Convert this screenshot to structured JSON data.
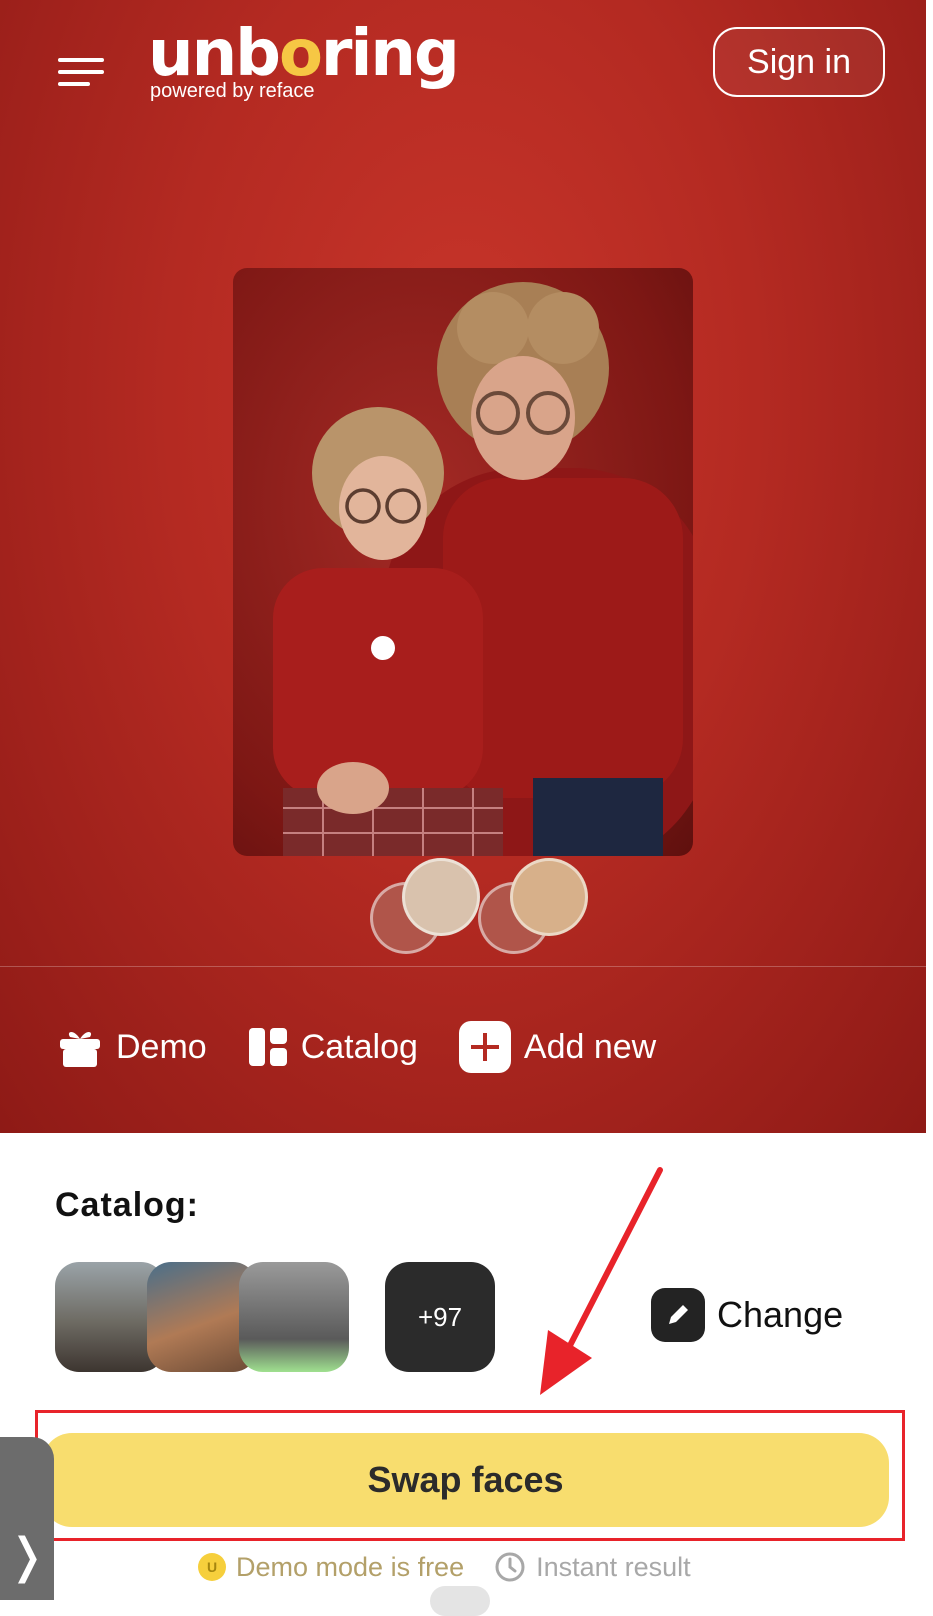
{
  "header": {
    "logo_text_prefix": "unb",
    "logo_text_o": "o",
    "logo_text_suffix": "ring",
    "logo_tagline": "powered by reface",
    "sign_in_label": "Sign in"
  },
  "actions": {
    "demo_label": "Demo",
    "catalog_label": "Catalog",
    "add_new_label": "Add new"
  },
  "catalog": {
    "title": "Catalog:",
    "more_count": "+97",
    "change_label": "Change"
  },
  "swap": {
    "label": "Swap faces"
  },
  "notes": {
    "coin_symbol": "U",
    "free_label": "Demo mode is free",
    "instant_label": "Instant result"
  },
  "side_tab": {
    "chevron": "❭"
  },
  "colors": {
    "hero_red": "#b42a22",
    "swap_yellow": "#f8dd6e",
    "highlight_red": "#e8232a"
  }
}
